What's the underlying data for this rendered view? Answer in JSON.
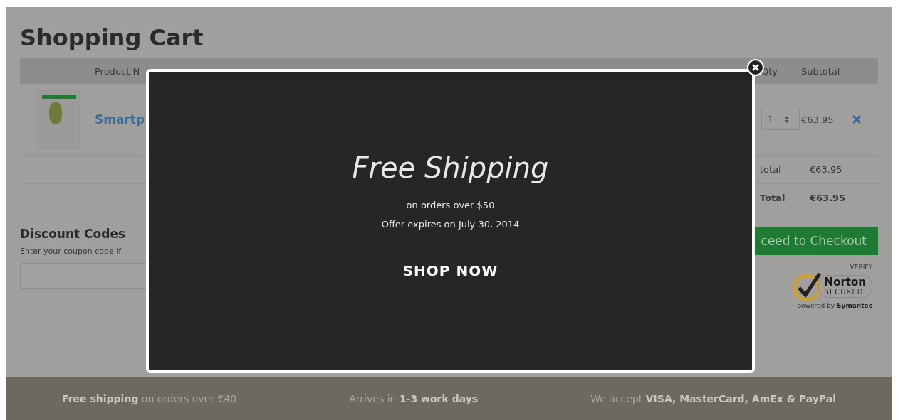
{
  "page": {
    "title": "Shopping Cart"
  },
  "cart_table": {
    "columns": [
      "Product N",
      "Qty",
      "Subtotal"
    ],
    "rows": [
      {
        "product_name": "Smartp",
        "qty": "1",
        "subtotal": "€63.95"
      }
    ],
    "totals": [
      {
        "label": "total",
        "value": "€63.95",
        "kind": "normal"
      },
      {
        "label": "Total",
        "value": "€63.95",
        "kind": "grand"
      }
    ]
  },
  "discount": {
    "heading": "Discount Codes",
    "hint": "Enter your coupon code if"
  },
  "checkout_button": "ceed to Checkout",
  "norton_badge": {
    "verify": "VERIFY",
    "name": "Norton",
    "secured": "SECURED",
    "powered_by": "powered by",
    "company": "Symantec"
  },
  "popup": {
    "title": "Free Shipping",
    "subtitle": "on orders over $50",
    "expiry": "Offer expires on July 30, 2014",
    "button": "SHOP NOW"
  },
  "footer": [
    "**Free shipping** on orders over €40",
    "Arrives in **1-3 work days**",
    "We accept **VISA, MasterCard, AmEx & PayPal**"
  ]
}
